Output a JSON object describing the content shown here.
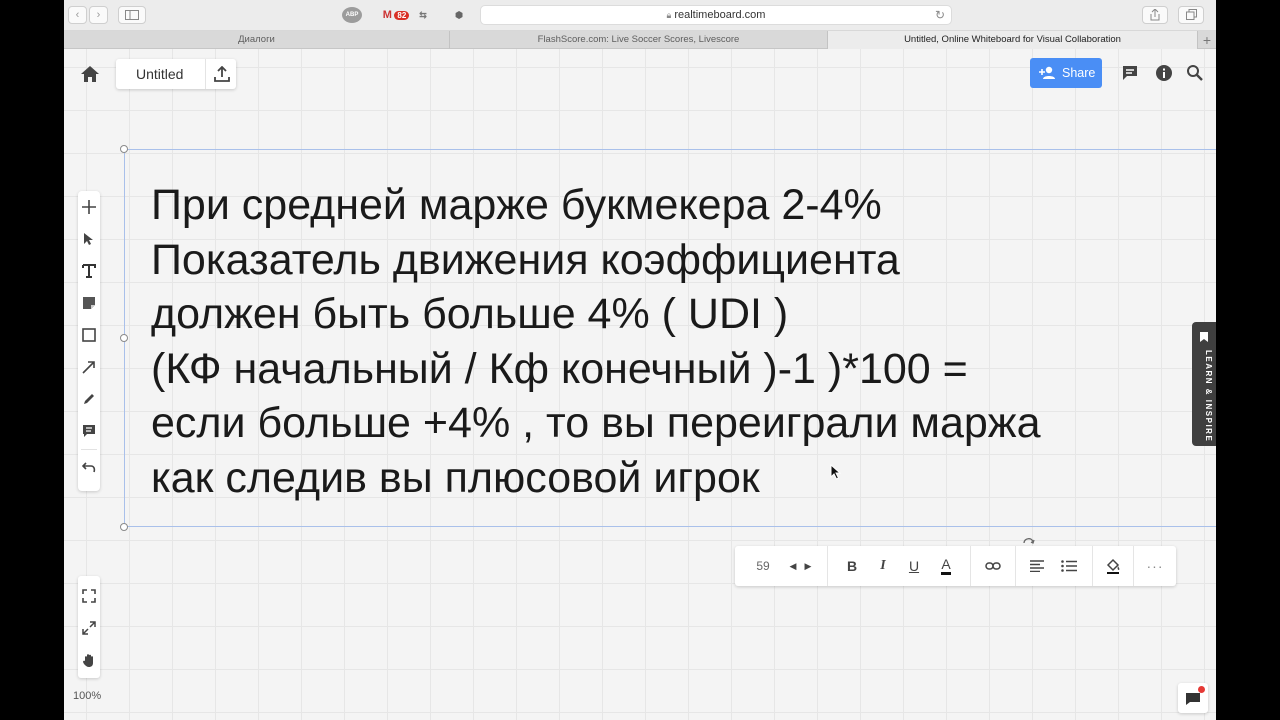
{
  "browser": {
    "url": "realtimeboard.com",
    "gmail_badge": "82",
    "extension_abp": "ABP",
    "tabs": [
      {
        "label": "Диалоги",
        "active": false
      },
      {
        "label": "FlashScore.com: Live Soccer Scores, Livescore",
        "active": false
      },
      {
        "label": "Untitled, Online Whiteboard for Visual Collaboration",
        "active": true
      }
    ]
  },
  "board": {
    "title": "Untitled",
    "share_label": "Share",
    "zoom": "100%",
    "learn_label": "LEARN & INSPIRE",
    "accent_color": "#4a8ef5"
  },
  "text_widget": {
    "lines": [
      "При средней марже букмекера 2-4%",
      "Показатель движения коэффициента",
      "должен быть больше 4% ( UDI )",
      "(КФ начальный / Кф конечный )-1 )*100 =",
      "если больше +4% , то вы переиграли маржа",
      "как следив вы плюсовой игрок"
    ]
  },
  "format_toolbar": {
    "font_size": "59",
    "bold": "B",
    "italic": "I",
    "underline": "U",
    "color_letter": "A",
    "more": "···"
  },
  "icons": {
    "home": "home-icon",
    "upload": "upload-icon",
    "comments": "comments-icon",
    "info": "info-icon",
    "search": "search-icon"
  }
}
